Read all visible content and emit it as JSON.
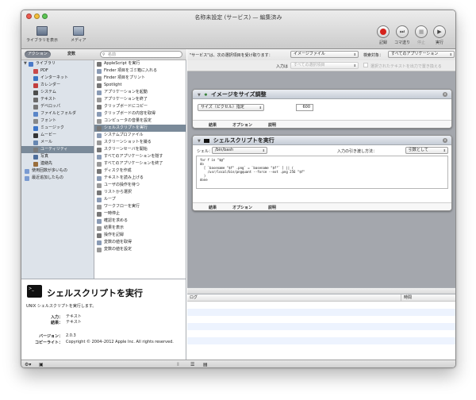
{
  "window": {
    "title": "名称未設定 (サービス) — 編集済み"
  },
  "toolbar": {
    "library_label": "ライブラリを表示",
    "media_label": "メディア",
    "record_label": "記録",
    "step_label": "コマ送り",
    "stop_label": "停止",
    "run_label": "実行"
  },
  "library_header": {
    "actions_tab": "アクション",
    "variables_tab": "変数",
    "search_placeholder": "名前"
  },
  "library": {
    "root": "ライブラリ",
    "items": [
      "PDF",
      "インターネット",
      "カレンダー",
      "システム",
      "テキスト",
      "デベロッパ",
      "ファイルとフォルダ",
      "フォント",
      "ミュージック",
      "ムービー",
      "メール",
      "ユーティリティ",
      "写真",
      "連絡先"
    ],
    "smart1": "使用回数が多いもの",
    "smart2": "最近追加したもの",
    "selected_index": 11
  },
  "actions": {
    "items": [
      "AppleScript を実行",
      "Finder 項目をゴミ箱に入れる",
      "Finder 項目をプリント",
      "Spotlight",
      "アプリケーションを起動",
      "アプリケーションを終了",
      "クリップボードにコピー",
      "クリップボードの内容を取得",
      "コンピュータの音量を設定",
      "シェルスクリプトを実行",
      "システムプロファイル",
      "スクリーンショットを撮る",
      "スクリーンセーバを開始",
      "すべてのアプリケーションを隠す",
      "すべてのアプリケーションを終了",
      "ディスクを作成",
      "テキストを読み上げる",
      "ユーザの操作を待つ",
      "リストから選択",
      "ループ",
      "ワークフローを実行",
      "一時停止",
      "確認を求める",
      "結果を表示",
      "操作を記録",
      "変数の値を取得",
      "変数の値を設定"
    ],
    "selected_index": 9
  },
  "description": {
    "title": "シェルスクリプトを実行",
    "summary": "UNIX シェルスクリプトを実行します。",
    "input_label": "入力：",
    "input_value": "テキスト",
    "result_label": "結果：",
    "result_value": "テキスト",
    "version_label": "バージョン：",
    "version_value": "2.0.3",
    "copyright_label": "コピーライト：",
    "copyright_value": "Copyright © 2004–2012 Apple Inc.  All rights reserved."
  },
  "service": {
    "receives_label": "\"サービス\"は、次の選択項目を受け取ります：",
    "receives_value": "イメージファイル",
    "target_label": "検索対象：",
    "target_value": "すべてのアプリケーション",
    "input_label": "入力は",
    "input_value": "すべての選択項目",
    "replace_label": "選択されたテキストを出力で置き換える"
  },
  "card1": {
    "title": "イメージをサイズ調整",
    "mode": "サイズ（ピクセル）指定",
    "size": "600",
    "tab_results": "結果",
    "tab_options": "オプション",
    "tab_description": "説明"
  },
  "card2": {
    "title": "シェルスクリプトを実行",
    "shell_label": "シェル：",
    "shell_value": "/bin/bash",
    "pass_label": "入力の引き渡し方法：",
    "pass_value": "引数として",
    "script": "for f in \"$@\"\ndo\n  [ `basename \"$f\" .png` = `basename \"$f\"` ] || (\n    /usr/local/bin/pngquant --force --ext .png 256 \"$f\"\n  )\ndone",
    "tab_results": "結果",
    "tab_options": "オプション",
    "tab_description": "説明"
  },
  "log": {
    "col_log": "ログ",
    "col_time": "時間"
  },
  "colors": {
    "selection": "#7a8a99",
    "sidebar": "#dde3ea",
    "workflow_bg": "#a4a7ad",
    "record": "#d5221b"
  }
}
